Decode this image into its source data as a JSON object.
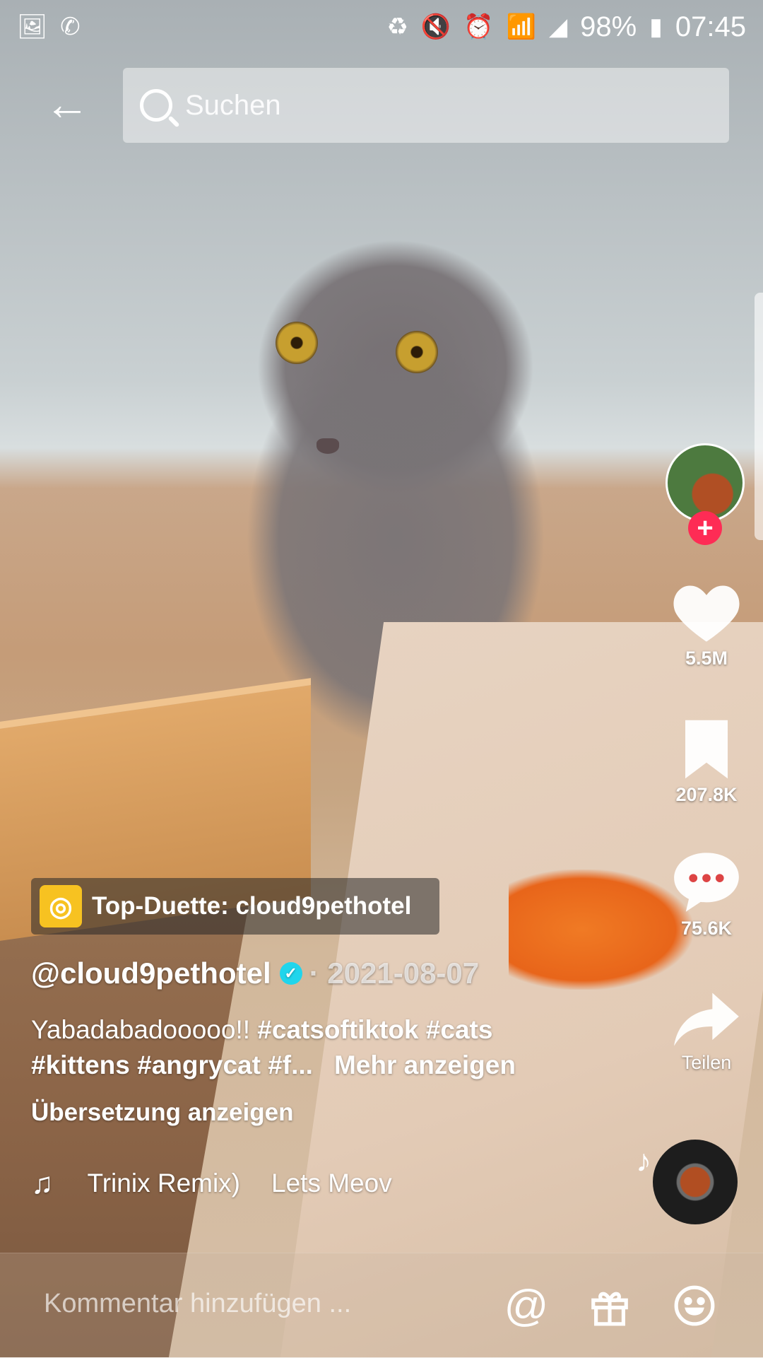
{
  "status_bar": {
    "left_icons": [
      "image-icon",
      "whatsapp-icon"
    ],
    "right_icons": [
      "battery-saver-icon",
      "mute-icon",
      "alarm-icon",
      "wifi-icon",
      "signal-icon"
    ],
    "battery": "98%",
    "time": "07:45"
  },
  "search": {
    "placeholder": "Suchen"
  },
  "rail": {
    "likes": "5.5M",
    "bookmarks": "207.8K",
    "comments": "75.6K",
    "share_label": "Teilen"
  },
  "duet": {
    "text": "Top-Duette: cloud9pethotel"
  },
  "post": {
    "author": "@cloud9pethotel",
    "date": "· 2021-08-07",
    "caption_text": "Yabadabadooooo!! ",
    "tag1": "#catsoftiktok",
    "tag2": "#cats",
    "tag3": "#kittens",
    "tag4": "#angrycat",
    "tag5": "#f...",
    "more": "Mehr anzeigen",
    "translate": "Übersetzung anzeigen",
    "music_part1": "Trinix Remix)",
    "music_part2": "Lets Meov"
  },
  "comment": {
    "placeholder": "Kommentar hinzufügen ..."
  },
  "colors": {
    "accent_red": "#fe2c55",
    "verified_blue": "#20d5ec",
    "duet_yellow": "#f7c221"
  }
}
